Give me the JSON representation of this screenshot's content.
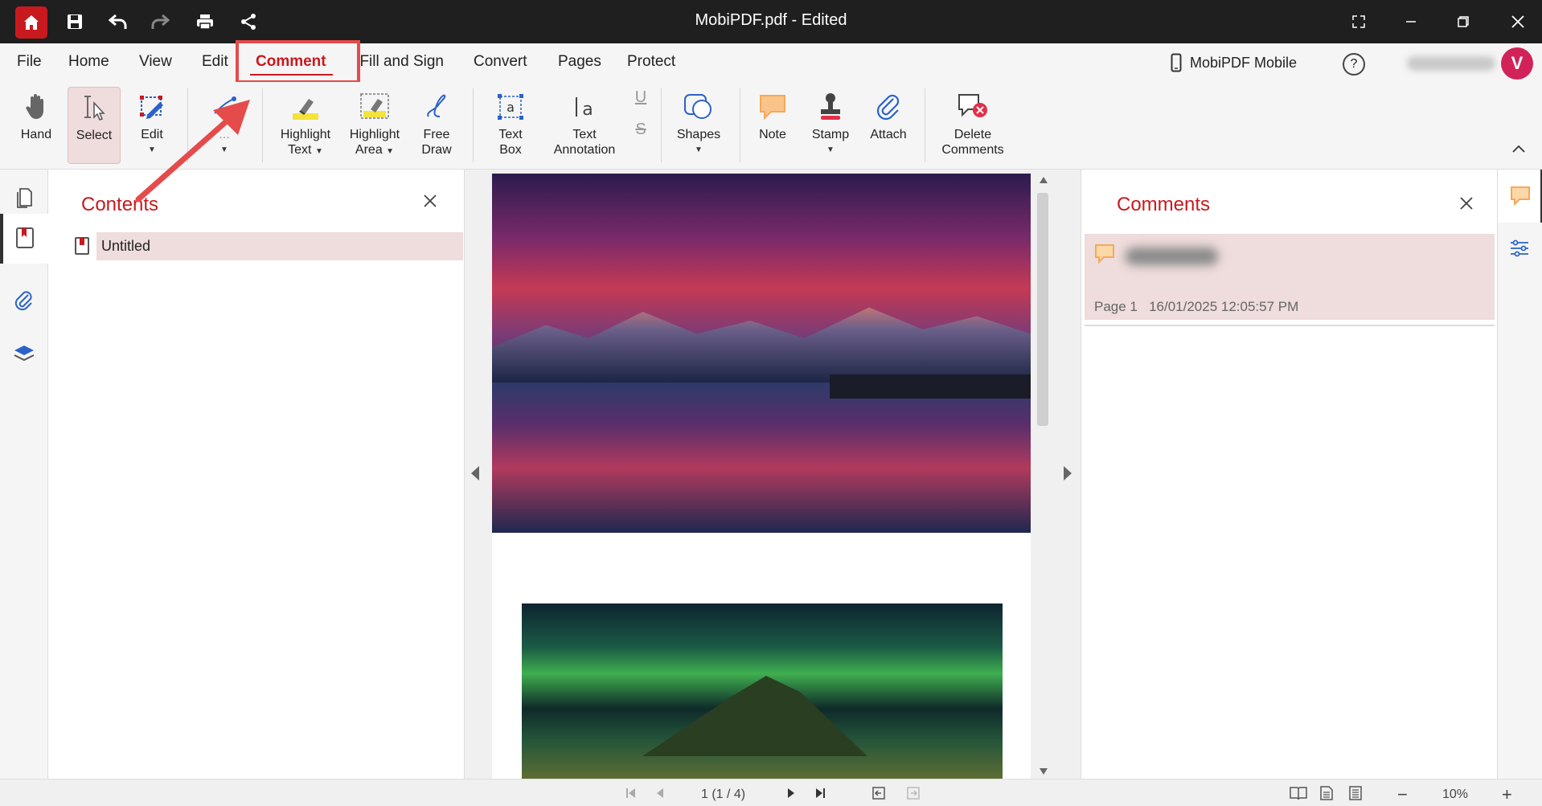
{
  "window": {
    "title": "MobiPDF.pdf - Edited"
  },
  "menu": {
    "items": [
      "File",
      "Home",
      "View",
      "Edit",
      "Comment",
      "Fill and Sign",
      "Convert",
      "Pages",
      "Protect"
    ],
    "active": "Comment"
  },
  "account": {
    "mobile_label": "MobiPDF Mobile",
    "help_label": "?",
    "avatar_initial": "V"
  },
  "ribbon": {
    "hand": "Hand",
    "select": "Select",
    "edit": "Edit",
    "highlight_text_1": "Highlight",
    "highlight_text_2": "Text",
    "highlight_area_1": "Highlight",
    "highlight_area_2": "Area",
    "free_draw_1": "Free",
    "free_draw_2": "Draw",
    "text_box_1": "Text",
    "text_box_2": "Box",
    "text_annotation_1": "Text",
    "text_annotation_2": "Annotation",
    "shapes": "Shapes",
    "note": "Note",
    "stamp": "Stamp",
    "attach": "Attach",
    "delete_comments_1": "Delete",
    "delete_comments_2": "Comments",
    "partial_label": "...",
    "underline_glyph": "U",
    "strike_glyph": "S"
  },
  "contents_panel": {
    "title": "Contents",
    "bookmarks": [
      "Untitled"
    ]
  },
  "comments_panel": {
    "title": "Comments",
    "items": [
      {
        "page": "Page 1",
        "timestamp": "16/01/2025 12:05:57 PM"
      }
    ]
  },
  "status": {
    "page_indicator": "1 (1 / 4)",
    "zoom": "10%",
    "minus": "−",
    "plus": "+"
  },
  "colors": {
    "accent": "#c8191f",
    "callout": "#e54b4b",
    "note": "#f5a85a",
    "highlight": "#f5e23a",
    "selection": "#efdcdc"
  }
}
